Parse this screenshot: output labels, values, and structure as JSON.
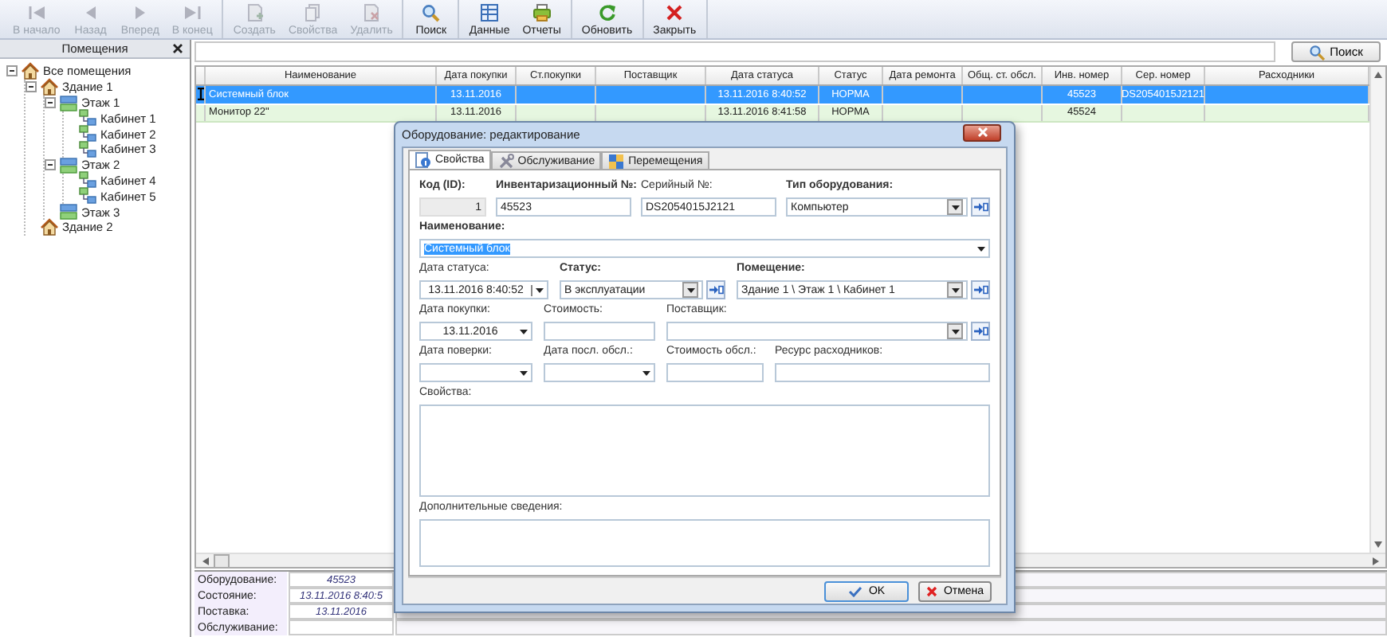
{
  "toolbar": [
    [
      {
        "label": "В начало",
        "disabled": true
      },
      {
        "label": "Назад",
        "disabled": true
      },
      {
        "label": "Вперед",
        "disabled": true
      },
      {
        "label": "В конец",
        "disabled": true
      }
    ],
    [
      {
        "label": "Создать",
        "disabled": true
      },
      {
        "label": "Свойства",
        "disabled": true
      },
      {
        "label": "Удалить",
        "disabled": true
      }
    ],
    [
      {
        "label": "Поиск",
        "disabled": false
      }
    ],
    [
      {
        "label": "Данные",
        "disabled": false
      },
      {
        "label": "Отчеты",
        "disabled": false
      }
    ],
    [
      {
        "label": "Обновить",
        "disabled": false
      }
    ],
    [
      {
        "label": "Закрыть",
        "disabled": false
      }
    ]
  ],
  "sidebar": {
    "title": "Помещения",
    "tree": [
      {
        "label": "Все помещения",
        "kind": "building",
        "expanded": true,
        "children": [
          {
            "label": "Здание 1",
            "kind": "building",
            "expanded": true,
            "children": [
              {
                "label": "Этаж 1",
                "kind": "floor",
                "expanded": true,
                "children": [
                  {
                    "label": "Кабинет 1",
                    "kind": "room"
                  },
                  {
                    "label": "Кабинет 2",
                    "kind": "room"
                  },
                  {
                    "label": "Кабинет 3",
                    "kind": "room"
                  }
                ]
              },
              {
                "label": "Этаж 2",
                "kind": "floor",
                "expanded": true,
                "children": [
                  {
                    "label": "Кабинет 4",
                    "kind": "room"
                  },
                  {
                    "label": "Кабинет 5",
                    "kind": "room"
                  }
                ]
              },
              {
                "label": "Этаж 3",
                "kind": "floor"
              }
            ]
          },
          {
            "label": "Здание 2",
            "kind": "building"
          }
        ]
      }
    ]
  },
  "search": {
    "button": "Поиск"
  },
  "table": {
    "columns": [
      "Наименование",
      "Дата покупки",
      "Ст.покупки",
      "Поставщик",
      "Дата статуса",
      "Статус",
      "Дата ремонта",
      "Общ. ст. обсл.",
      "Инв. номер",
      "Сер. номер",
      "Расходники"
    ],
    "rows": [
      {
        "selected": true,
        "cells": [
          "Системный блок",
          "13.11.2016",
          null,
          null,
          "13.11.2016 8:40:52",
          "НОРМА",
          null,
          null,
          "45523",
          "DS2054015J2121",
          null
        ]
      },
      {
        "selected": false,
        "cells": [
          "Монитор 22\"",
          "13.11.2016",
          null,
          null,
          "13.11.2016 8:41:58",
          "НОРМА",
          null,
          null,
          "45524",
          null,
          null
        ]
      }
    ]
  },
  "summary": [
    {
      "label": "Оборудование:",
      "value": "45523"
    },
    {
      "label": "Состояние:",
      "value": "13.11.2016 8:40:5"
    },
    {
      "label": "Поставка:",
      "value": "13.11.2016"
    },
    {
      "label": "Обслуживание:"
    }
  ],
  "dialog": {
    "title": "Оборудование: редактирование",
    "tabs": [
      {
        "label": "Свойства",
        "selected": true
      },
      {
        "label": "Обслуживание",
        "selected": false
      },
      {
        "label": "Перемещения",
        "selected": false
      }
    ],
    "rows": [
      [
        {
          "label": "Код (ID):",
          "required": true,
          "kind": "readonly",
          "value": "1"
        },
        {
          "label": "Инвентаризационный №:",
          "required": true,
          "kind": "text",
          "value": "45523"
        },
        {
          "label": "Серийный №:",
          "required": false,
          "kind": "text",
          "value": "DS2054015J2121"
        },
        {
          "label": "Тип оборудования:",
          "required": true,
          "kind": "combo",
          "link": true,
          "value": "Компьютер"
        }
      ],
      [
        {
          "label": "Наименование:",
          "required": true,
          "kind": "editcombo",
          "value": "Системный блок",
          "text_selected": true
        }
      ],
      [
        {
          "label": "Дата статуса:",
          "required": false,
          "kind": "datetime",
          "value": "13.11.2016 8:40:52"
        },
        {
          "label": "Статус:",
          "required": true,
          "kind": "combo",
          "link": true,
          "value": "В эксплуатации"
        },
        {
          "label": "Помещение:",
          "required": true,
          "kind": "combo",
          "link": true,
          "value": "Здание 1 \\ Этаж 1 \\ Кабинет 1"
        }
      ],
      [
        {
          "label": "Дата покупки:",
          "required": false,
          "kind": "date",
          "value": "13.11.2016"
        },
        {
          "label": "Стоимость:",
          "required": false,
          "kind": "text"
        },
        {
          "label": "Поставщик:",
          "required": false,
          "kind": "combo",
          "link": true
        }
      ],
      [
        {
          "label": "Дата поверки:",
          "required": false,
          "kind": "date"
        },
        {
          "label": "Дата посл. обсл.:",
          "required": false,
          "kind": "date"
        },
        {
          "label": "Стоимость обсл.:",
          "required": false,
          "kind": "text"
        },
        {
          "label": "Ресурс расходников:",
          "required": false,
          "kind": "text"
        }
      ],
      [
        {
          "label": "Свойства:",
          "required": false,
          "kind": "memo"
        }
      ],
      [
        {
          "label": "Дополнительные сведения:",
          "required": false,
          "kind": "memo"
        }
      ]
    ],
    "buttons": [
      {
        "label": "OK",
        "kind": "ok"
      },
      {
        "label": "Отмена",
        "kind": "cancel"
      }
    ]
  }
}
